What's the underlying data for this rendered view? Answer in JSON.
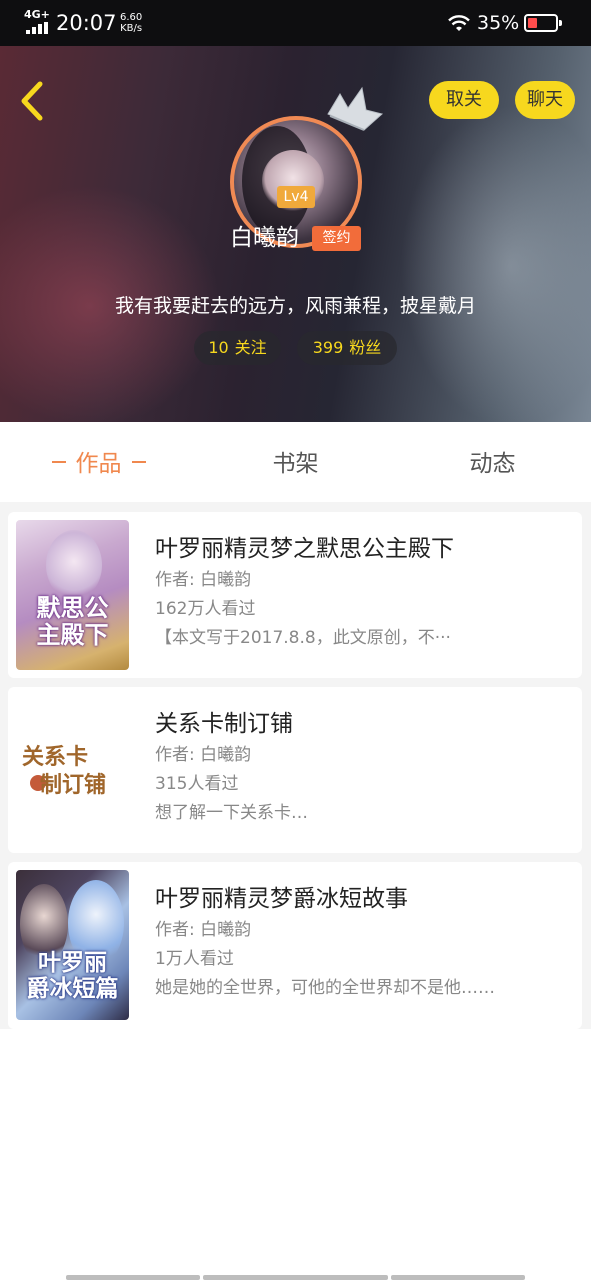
{
  "status_bar": {
    "network": "4G+",
    "time": "20:07",
    "speed_value": "6.60",
    "speed_unit": "KB/s",
    "battery_percent": "35%",
    "battery_level": 0.35,
    "icons": [
      "signal-icon",
      "wifi-icon",
      "battery-icon"
    ]
  },
  "header": {
    "back_icon": "chevron-left-icon",
    "unfollow_label": "取关",
    "chat_label": "聊天",
    "level": "Lv4",
    "username": "白曦韵",
    "contract_badge": "签约",
    "bio": "我有我要赶去的远方，风雨兼程，披星戴月",
    "following_count": "10",
    "following_label": "关注",
    "fans_count": "399",
    "fans_label": "粉丝",
    "accent_color": "#f7d81e"
  },
  "tabs": [
    {
      "label": "作品",
      "active": true
    },
    {
      "label": "书架",
      "active": false
    },
    {
      "label": "动态",
      "active": false
    }
  ],
  "books": [
    {
      "title": "叶罗丽精灵梦之默思公主殿下",
      "author": "作者: 白曦韵",
      "views": "162万人看过",
      "desc": "【本文写于2017.8.8，此文原创，不···",
      "cover_text": [
        "默思公",
        "主殿下"
      ]
    },
    {
      "title": "关系卡制订铺",
      "author": "作者: 白曦韵",
      "views": "315人看过",
      "desc": "想了解一下关系卡…",
      "cover_text": [
        "关系卡",
        "制订铺"
      ]
    },
    {
      "title": "叶罗丽精灵梦爵冰短故事",
      "author": "作者: 白曦韵",
      "views": "1万人看过",
      "desc": "她是她的全世界，可他的全世界却不是他……",
      "cover_text": [
        "叶罗丽",
        "爵冰短篇"
      ]
    }
  ]
}
